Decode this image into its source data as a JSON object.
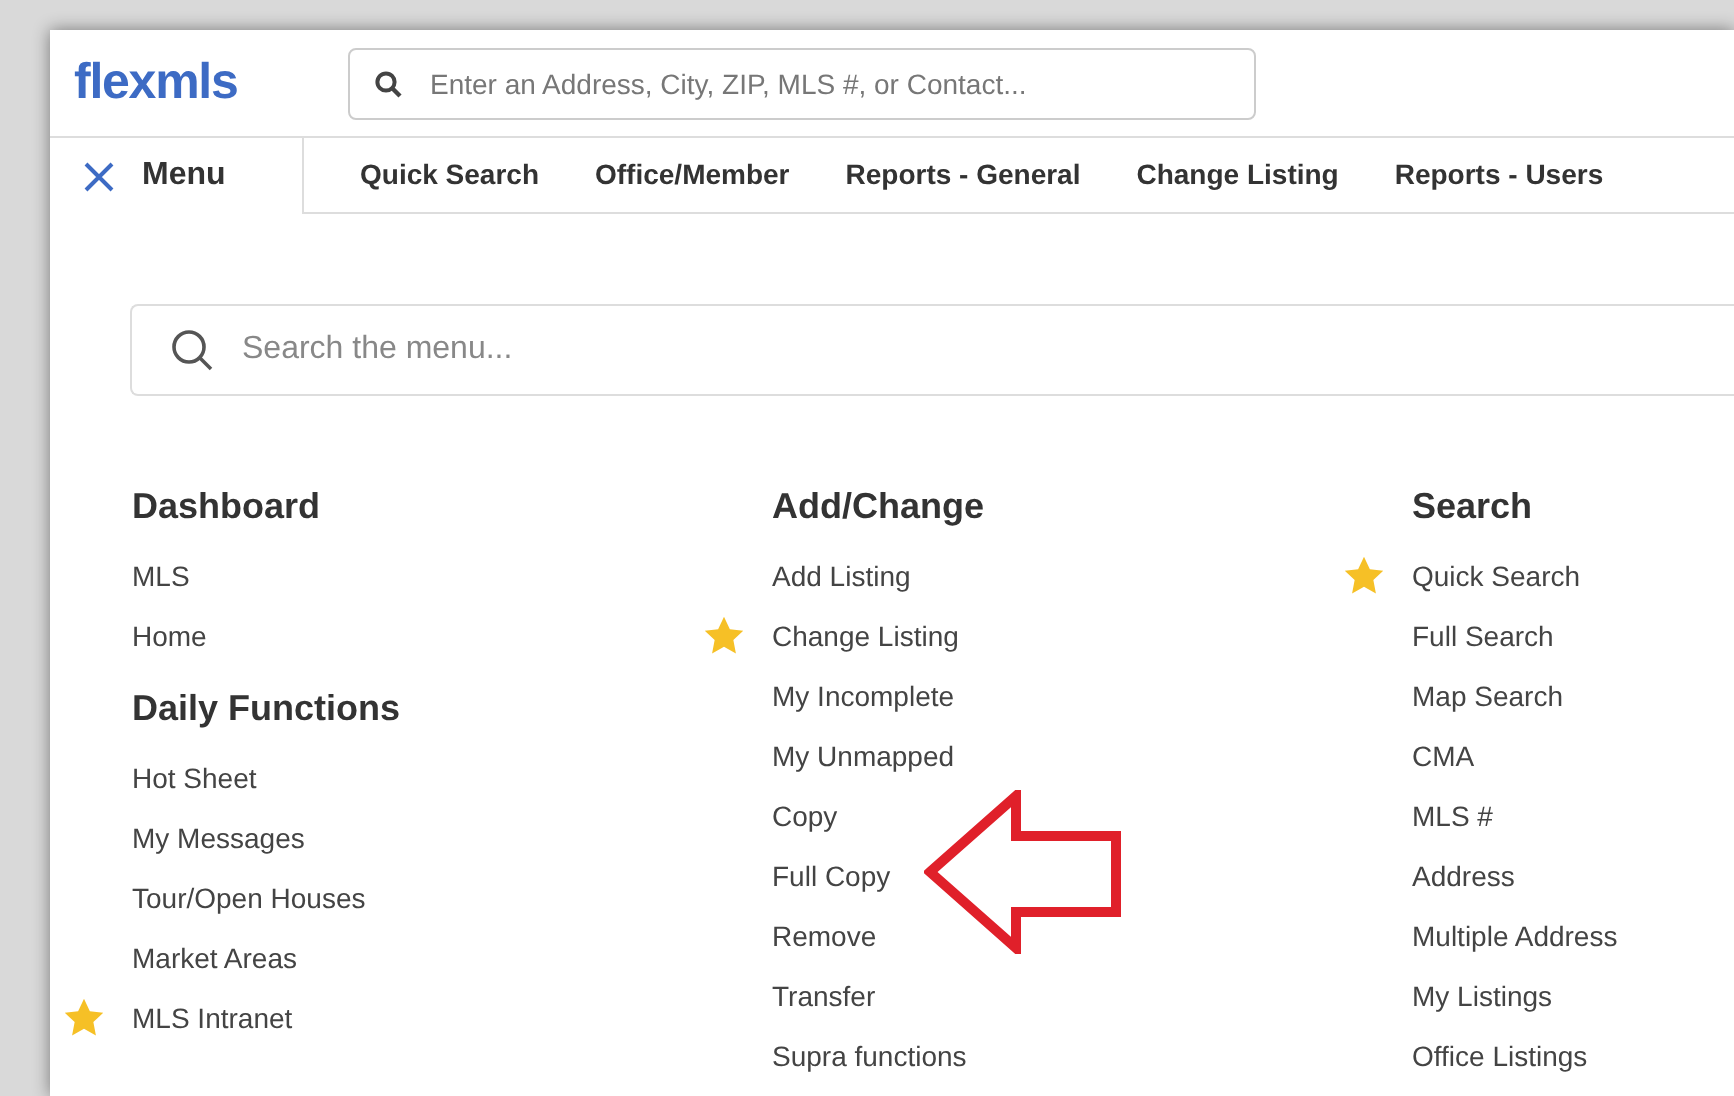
{
  "header": {
    "logo": "flexmls",
    "search": {
      "placeholder": "Enter an Address, City, ZIP, MLS #, or Contact..."
    }
  },
  "nav": {
    "menu": {
      "label": "Menu",
      "expanded": true
    },
    "links": [
      "Quick Search",
      "Office/Member",
      "Reports - General",
      "Change Listing",
      "Reports - Users"
    ]
  },
  "menu_search": {
    "placeholder": "Search the menu..."
  },
  "columns": [
    {
      "sections": [
        {
          "heading": "Dashboard",
          "items": [
            {
              "label": "MLS",
              "favorite": false
            },
            {
              "label": "Home",
              "favorite": false
            }
          ]
        },
        {
          "heading": "Daily Functions",
          "items": [
            {
              "label": "Hot Sheet",
              "favorite": false
            },
            {
              "label": "My Messages",
              "favorite": false
            },
            {
              "label": "Tour/Open Houses",
              "favorite": false
            },
            {
              "label": "Market Areas",
              "favorite": false
            },
            {
              "label": "MLS Intranet",
              "favorite": true
            }
          ]
        }
      ]
    },
    {
      "sections": [
        {
          "heading": "Add/Change",
          "items": [
            {
              "label": "Add Listing",
              "favorite": false
            },
            {
              "label": "Change Listing",
              "favorite": true
            },
            {
              "label": "My Incomplete",
              "favorite": false
            },
            {
              "label": "My Unmapped",
              "favorite": false
            },
            {
              "label": "Copy",
              "favorite": false
            },
            {
              "label": "Full Copy",
              "favorite": false,
              "highlighted": true
            },
            {
              "label": "Remove",
              "favorite": false
            },
            {
              "label": "Transfer",
              "favorite": false
            },
            {
              "label": "Supra functions",
              "favorite": false
            }
          ]
        }
      ]
    },
    {
      "sections": [
        {
          "heading": "Search",
          "items": [
            {
              "label": "Quick Search",
              "favorite": true
            },
            {
              "label": "Full Search",
              "favorite": false
            },
            {
              "label": "Map Search",
              "favorite": false
            },
            {
              "label": "CMA",
              "favorite": false
            },
            {
              "label": "MLS #",
              "favorite": false
            },
            {
              "label": "Address",
              "favorite": false
            },
            {
              "label": "Multiple Address",
              "favorite": false
            },
            {
              "label": "My Listings",
              "favorite": false
            },
            {
              "label": "Office Listings",
              "favorite": false
            }
          ]
        }
      ]
    }
  ]
}
